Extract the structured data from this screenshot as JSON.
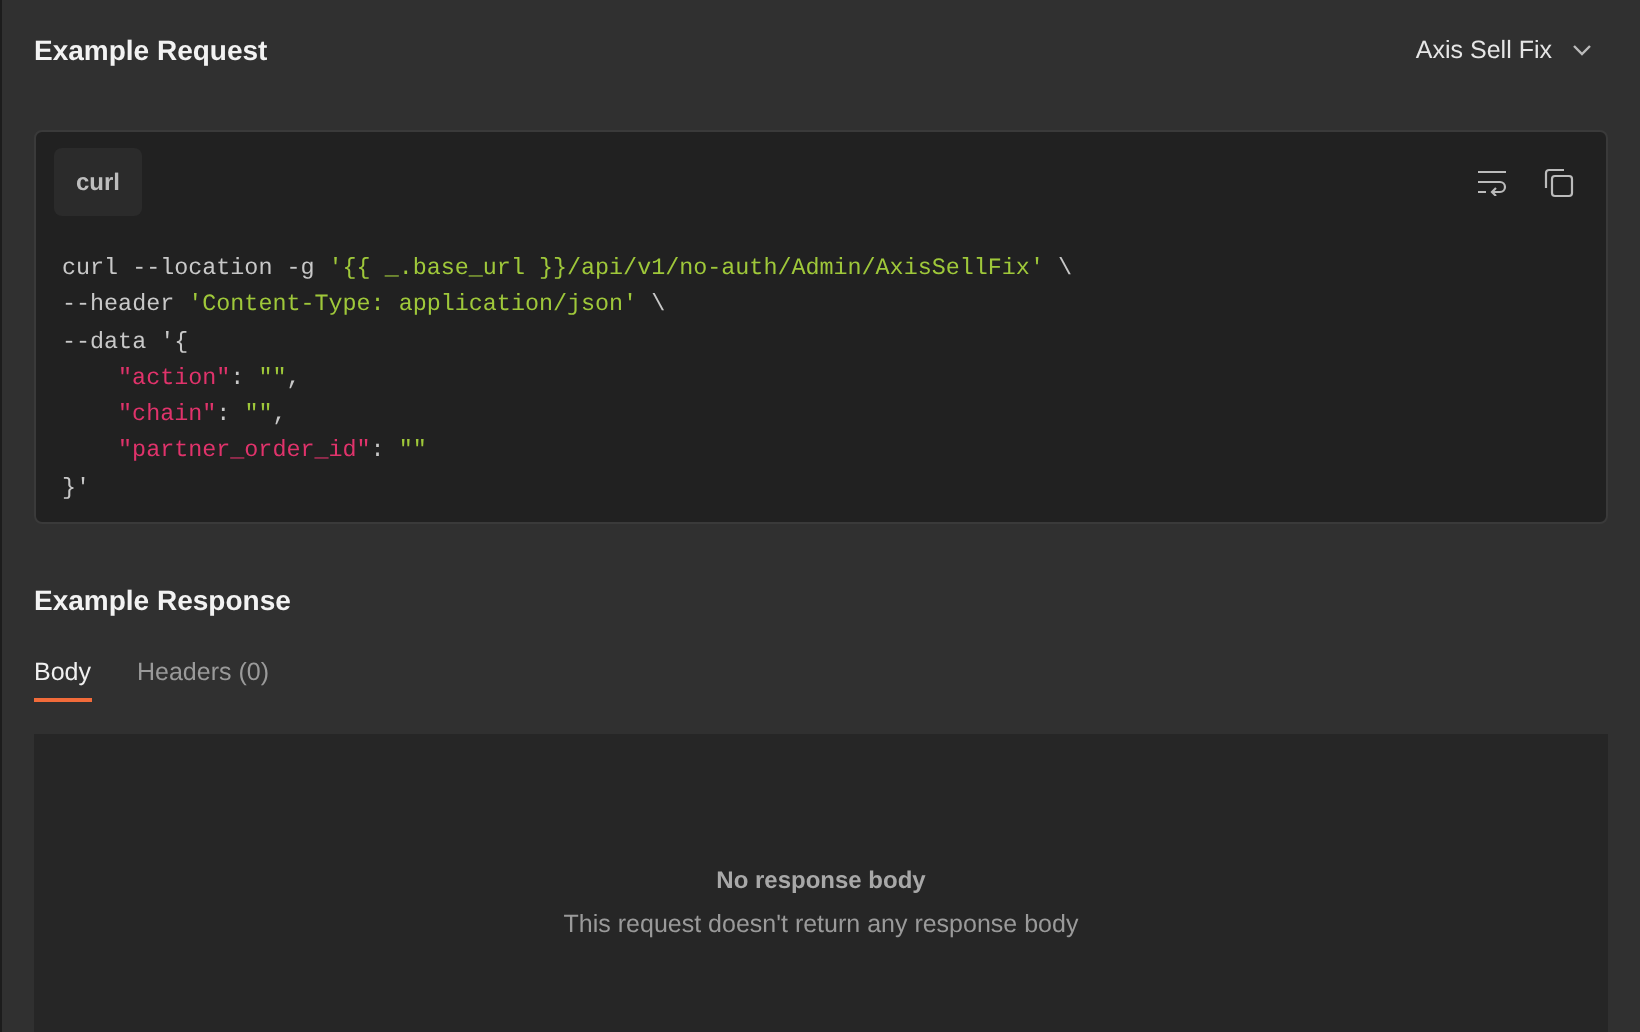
{
  "request": {
    "title": "Example Request",
    "example_selector": "Axis Sell Fix",
    "language_tab": "curl",
    "code_lines": [
      [
        {
          "kind": "plain",
          "text": "curl --location -g "
        },
        {
          "kind": "string",
          "text": "'{{ _.base_url }}/api/v1/no-auth/Admin/AxisSellFix'"
        },
        {
          "kind": "plain",
          "text": " \\"
        }
      ],
      [
        {
          "kind": "plain",
          "text": "--header "
        },
        {
          "kind": "string",
          "text": "'Content-Type: application/json'"
        },
        {
          "kind": "plain",
          "text": " \\"
        }
      ],
      [
        {
          "kind": "plain",
          "text": "--data '{"
        }
      ],
      [
        {
          "kind": "indent"
        },
        {
          "kind": "key",
          "text": "\"action\""
        },
        {
          "kind": "plain",
          "text": ": "
        },
        {
          "kind": "string",
          "text": "\"\""
        },
        {
          "kind": "plain",
          "text": ","
        }
      ],
      [
        {
          "kind": "indent"
        },
        {
          "kind": "key",
          "text": "\"chain\""
        },
        {
          "kind": "plain",
          "text": ": "
        },
        {
          "kind": "string",
          "text": "\"\""
        },
        {
          "kind": "plain",
          "text": ","
        }
      ],
      [
        {
          "kind": "indent"
        },
        {
          "kind": "key",
          "text": "\"partner_order_id\""
        },
        {
          "kind": "plain",
          "text": ": "
        },
        {
          "kind": "string",
          "text": "\"\""
        }
      ],
      [
        {
          "kind": "plain",
          "text": "}'"
        }
      ]
    ]
  },
  "response": {
    "title": "Example Response",
    "tabs": [
      {
        "label": "Body",
        "selected": true
      },
      {
        "label": "Headers (0)",
        "selected": false
      }
    ],
    "empty_title": "No response body",
    "empty_text": "This request doesn't return any response body"
  }
}
